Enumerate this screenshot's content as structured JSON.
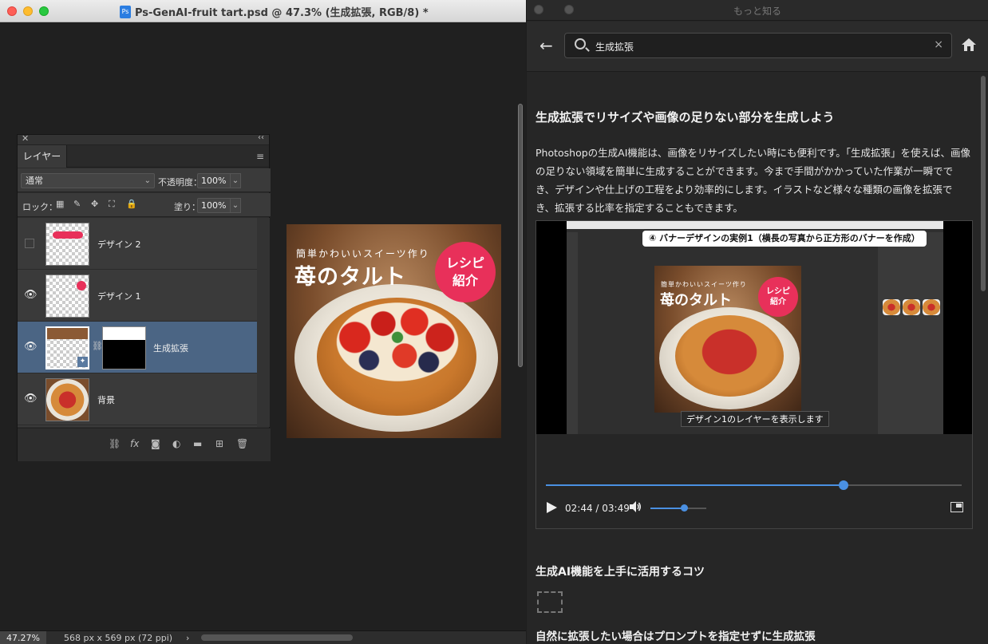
{
  "photoshop": {
    "window_title": "Ps-GenAI-fruit tart.psd @ 47.3% (生成拡張, RGB/8) *",
    "doc_icon": "Ps",
    "layers_panel": {
      "tab_label": "レイヤー",
      "blend_mode": "通常",
      "opacity_label": "不透明度：",
      "opacity_value": "100%",
      "lock_label": "ロック：",
      "fill_label": "塗り：",
      "fill_value": "100%",
      "layers": [
        {
          "name": "デザイン 2",
          "visible": false
        },
        {
          "name": "デザイン 1",
          "visible": true
        },
        {
          "name": "生成拡張",
          "visible": true,
          "selected": true,
          "has_mask": true
        },
        {
          "name": "背景",
          "visible": true
        }
      ],
      "bottom_icons": [
        "link-icon",
        "fx-icon",
        "mask-icon",
        "adjustment-icon",
        "folder-icon",
        "new-layer-icon",
        "trash-icon"
      ]
    },
    "canvas_text": {
      "subtitle": "簡単かわいいスイーツ作り",
      "title": "苺のタルト",
      "badge": "レシピ\n紹介"
    },
    "status": {
      "zoom": "47.27%",
      "doc_size": "568 px x 569 px (72 ppi)"
    }
  },
  "help": {
    "window_title": "もっと知る",
    "search_value": "生成拡張",
    "article_heading": "生成拡張でリサイズや画像の足りない部分を生成しよう",
    "article_body": "Photoshopの生成AI機能は、画像をリサイズしたい時にも便利です。「生成拡張」を使えば、画像の足りない領域を簡単に生成することができます。今まで手間がかかっていた作業が一瞬ででき、デザインや仕上げの工程をより効率的にします。イラストなど様々な種類の画像を拡張でき、拡張する比率を指定することもできます。",
    "video": {
      "caption_top": "④ バナーデザインの実例1（横長の写真から正方形のバナーを作成）",
      "subtitle": "デザイン1のレイヤーを表示します",
      "inner_canvas_subtitle": "簡単かわいいスイーツ作り",
      "inner_canvas_title": "苺のタルト",
      "inner_canvas_badge": "レシピ\n紹介",
      "current_time": "02:44",
      "duration": "03:49",
      "time_display": "02:44 / 03:49",
      "progress": 0.716,
      "volume": 0.6
    },
    "section_heading": "生成AI機能を上手に活用するコツ",
    "sub_heading": "自然に拡張したい場合はプロンプトを指定せずに生成拡張"
  }
}
